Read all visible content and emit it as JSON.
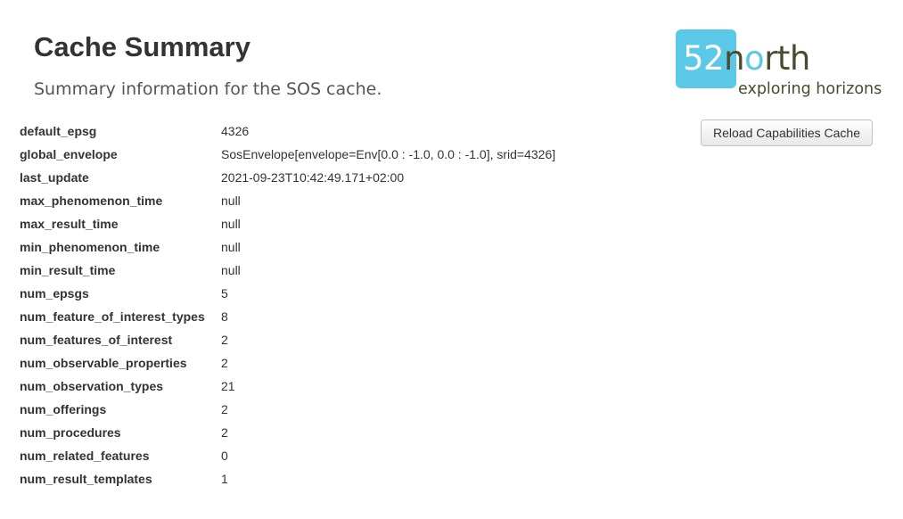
{
  "header": {
    "title": "Cache Summary",
    "subtitle": "Summary information for the SOS cache."
  },
  "logo": {
    "digits": "52",
    "o": "o",
    "word_rest_first": "n",
    "word_rest": "rth",
    "tagline": "exploring horizons",
    "brand_color": "#5bc8e8",
    "text_color": "#4a4a2e"
  },
  "actions": {
    "reload_label": "Reload Capabilities Cache"
  },
  "summary": {
    "rows": [
      {
        "key": "default_epsg",
        "value": "4326"
      },
      {
        "key": "global_envelope",
        "value": "SosEnvelope[envelope=Env[0.0 : -1.0, 0.0 : -1.0], srid=4326]"
      },
      {
        "key": "last_update",
        "value": "2021-09-23T10:42:49.171+02:00"
      },
      {
        "key": "max_phenomenon_time",
        "value": "null"
      },
      {
        "key": "max_result_time",
        "value": "null"
      },
      {
        "key": "min_phenomenon_time",
        "value": "null"
      },
      {
        "key": "min_result_time",
        "value": "null"
      },
      {
        "key": "num_epsgs",
        "value": "5"
      },
      {
        "key": "num_feature_of_interest_types",
        "value": "8"
      },
      {
        "key": "num_features_of_interest",
        "value": "2"
      },
      {
        "key": "num_observable_properties",
        "value": "2"
      },
      {
        "key": "num_observation_types",
        "value": "21"
      },
      {
        "key": "num_offerings",
        "value": "2"
      },
      {
        "key": "num_procedures",
        "value": "2"
      },
      {
        "key": "num_related_features",
        "value": "0"
      },
      {
        "key": "num_result_templates",
        "value": "1"
      }
    ]
  }
}
